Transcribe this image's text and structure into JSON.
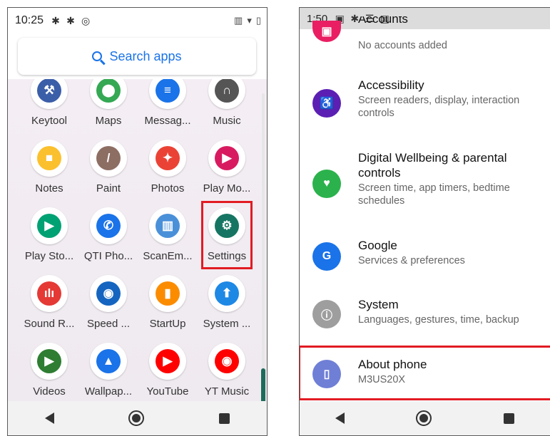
{
  "left": {
    "status": {
      "time": "10:25"
    },
    "search_label": "Search apps",
    "apps": [
      {
        "label": "Keytool",
        "icon": "keytool-icon",
        "color": "#3b5ea8"
      },
      {
        "label": "Maps",
        "icon": "maps-icon",
        "color": "#34a853"
      },
      {
        "label": "Messag...",
        "icon": "messages-icon",
        "color": "#1a73e8"
      },
      {
        "label": "Music",
        "icon": "music-icon",
        "color": "#555"
      },
      {
        "label": "Notes",
        "icon": "notes-icon",
        "color": "#fbc02d"
      },
      {
        "label": "Paint",
        "icon": "paint-icon",
        "color": "#8d6e63"
      },
      {
        "label": "Photos",
        "icon": "photos-icon",
        "color": "#ea4335"
      },
      {
        "label": "Play Mo...",
        "icon": "play-movies-icon",
        "color": "#d81b60"
      },
      {
        "label": "Play Sto...",
        "icon": "play-store-icon",
        "color": "#00a173"
      },
      {
        "label": "QTI Pho...",
        "icon": "phone-icon",
        "color": "#1a73e8"
      },
      {
        "label": "ScanEm...",
        "icon": "barcode-scanner-icon",
        "color": "#4a90d9"
      },
      {
        "label": "Settings",
        "icon": "gear-icon",
        "color": "#157562"
      },
      {
        "label": "Sound R...",
        "icon": "sound-recorder-icon",
        "color": "#e53935"
      },
      {
        "label": "Speed ...",
        "icon": "speed-test-icon",
        "color": "#1565c0"
      },
      {
        "label": "StartUp",
        "icon": "startup-icon",
        "color": "#fb8c00"
      },
      {
        "label": "System ...",
        "icon": "system-update-icon",
        "color": "#1e88e5"
      },
      {
        "label": "Videos",
        "icon": "videos-icon",
        "color": "#2e7d32"
      },
      {
        "label": "Wallpap...",
        "icon": "wallpaper-icon",
        "color": "#1a73e8"
      },
      {
        "label": "YouTube",
        "icon": "youtube-icon",
        "color": "#ff0000"
      },
      {
        "label": "YT Music",
        "icon": "yt-music-icon",
        "color": "#ff0000"
      }
    ]
  },
  "right": {
    "status": {
      "time": "1:50"
    },
    "items": [
      {
        "title": "Accounts",
        "subtitle": "No accounts added",
        "icon": "accounts-icon",
        "color": "#e91e63"
      },
      {
        "title": "Accessibility",
        "subtitle": "Screen readers, display, interaction controls",
        "icon": "accessibility-icon",
        "color": "#5b1fb3"
      },
      {
        "title": "Digital Wellbeing & parental controls",
        "subtitle": "Screen time, app timers, bedtime schedules",
        "icon": "wellbeing-icon",
        "color": "#2bb24c"
      },
      {
        "title": "Google",
        "subtitle": "Services & preferences",
        "icon": "google-icon",
        "color": "#1a73e8"
      },
      {
        "title": "System",
        "subtitle": "Languages, gestures, time, backup",
        "icon": "info-icon",
        "color": "#9e9e9e"
      },
      {
        "title": "About phone",
        "subtitle": "M3US20X",
        "icon": "phone-info-icon",
        "color": "#6f7fd6"
      }
    ]
  },
  "colors": {
    "highlight": "#e21b23"
  }
}
